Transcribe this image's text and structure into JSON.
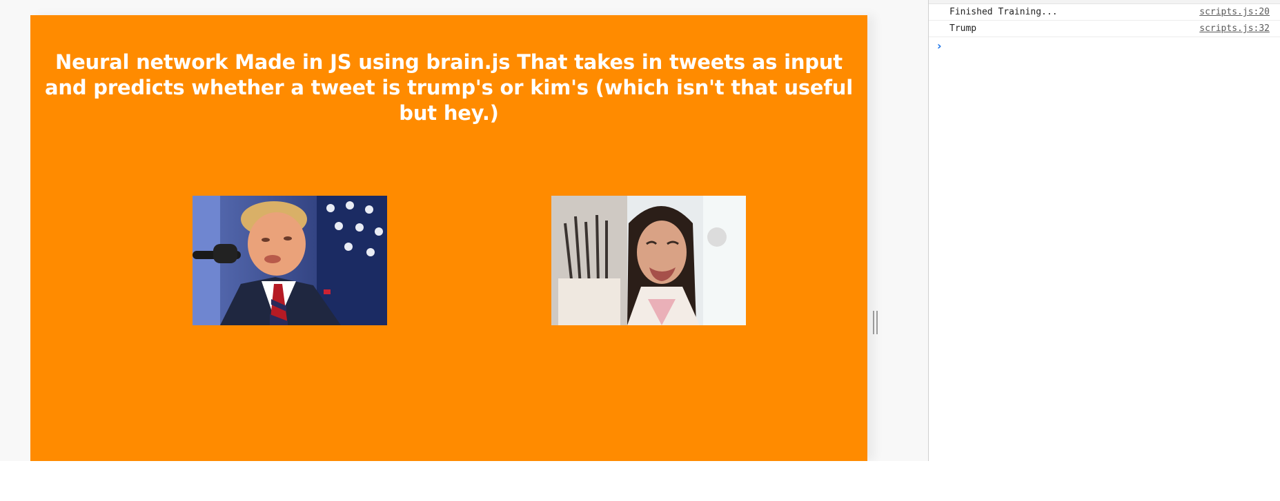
{
  "page": {
    "title": "Neural network Made in JS using brain.js That takes in tweets as input and predicts whether a tweet is trump's or kim's (which isn't that useful but hey.)",
    "background_color": "#ff8b00",
    "title_color": "#ffffff",
    "images": [
      {
        "name": "trump-photo"
      },
      {
        "name": "kim-photo"
      }
    ]
  },
  "console": {
    "messages": [
      {
        "text": "Finished Training...",
        "source": "scripts.js:20"
      },
      {
        "text": "Trump",
        "source": "scripts.js:32"
      }
    ],
    "prompt_symbol": "›",
    "prompt_color": "#1a73e8"
  }
}
